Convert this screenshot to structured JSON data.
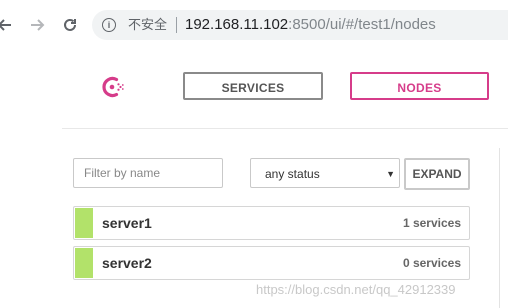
{
  "browser": {
    "back_icon": "arrow-left-icon",
    "forward_icon": "arrow-right-icon",
    "reload_icon": "reload-icon",
    "security_label": "不安全",
    "url_host": "192.168.11.102",
    "url_rest": ":8500/ui/#/test1/nodes"
  },
  "header": {
    "logo_icon": "consul-logo-icon",
    "tabs": [
      {
        "label": "SERVICES",
        "active": false
      },
      {
        "label": "NODES",
        "active": true
      }
    ]
  },
  "filters": {
    "name_placeholder": "Filter by name",
    "name_value": "",
    "status_selected": "any status",
    "expand_label": "EXPAND"
  },
  "nodes": [
    {
      "name": "server1",
      "services": "1 services",
      "status_color": "#b2e26a"
    },
    {
      "name": "server2",
      "services": "0 services",
      "status_color": "#b2e26a"
    }
  ],
  "watermark": "https://blog.csdn.net/qq_42912339",
  "colors": {
    "accent": "#d63c8a",
    "passing": "#b2e26a"
  }
}
